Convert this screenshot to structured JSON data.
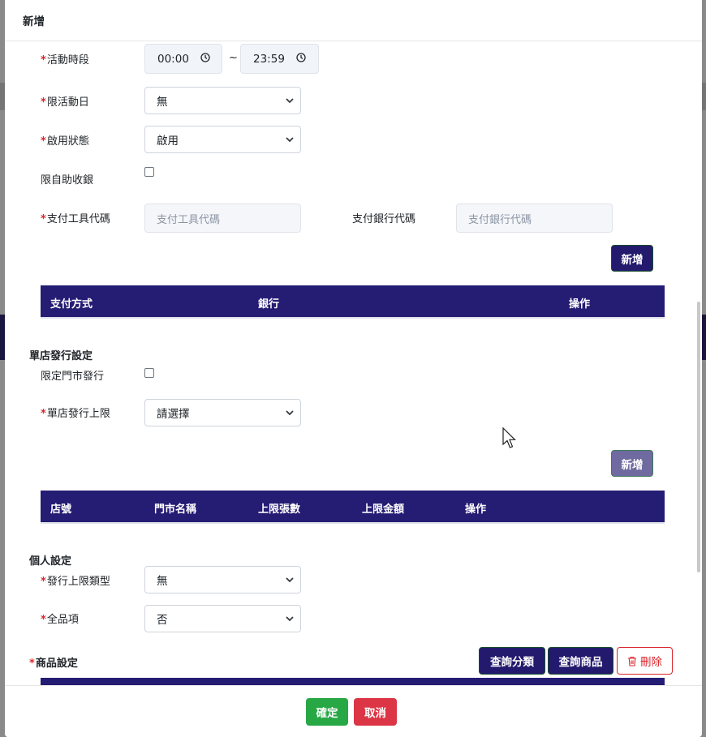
{
  "modal": {
    "title": "新增"
  },
  "form": {
    "activity_time": {
      "label": "活動時段",
      "start": "00:00",
      "end": "23:59",
      "separator": "~"
    },
    "limit_activity_day": {
      "label": "限活動日",
      "value": "無"
    },
    "enable_status": {
      "label": "啟用狀態",
      "value": "啟用"
    },
    "self_checkout": {
      "label": "限自助收銀"
    },
    "payment_tool_code": {
      "label": "支付工具代碼",
      "placeholder": "支付工具代碼"
    },
    "payment_bank_code": {
      "label": "支付銀行代碼",
      "placeholder": "支付銀行代碼"
    },
    "required_mark": "*"
  },
  "payment_section": {
    "add_label": "新增",
    "columns": [
      "支付方式",
      "銀行",
      "操作"
    ]
  },
  "store_section": {
    "title": "單店發行設定",
    "limit_store_issue": {
      "label": "限定門市發行"
    },
    "store_issue_limit": {
      "label": "單店發行上限",
      "value": "請選擇"
    },
    "add_label": "新增",
    "columns": [
      "店號",
      "門市名稱",
      "上限張數",
      "上限金額",
      "操作"
    ]
  },
  "personal_section": {
    "title": "個人設定",
    "issue_limit_type": {
      "label": "發行上限類型",
      "value": "無"
    },
    "all_items": {
      "label": "全品項",
      "value": "否"
    }
  },
  "product_section": {
    "title": "商品設定",
    "query_category_label": "查詢分類",
    "query_product_label": "查詢商品",
    "delete_label": "刪除"
  },
  "footer": {
    "confirm_label": "確定",
    "cancel_label": "取消"
  },
  "colors": {
    "navy": "#251c73",
    "required": "#d9262c",
    "confirm": "#28a745",
    "cancel": "#dc3545"
  }
}
